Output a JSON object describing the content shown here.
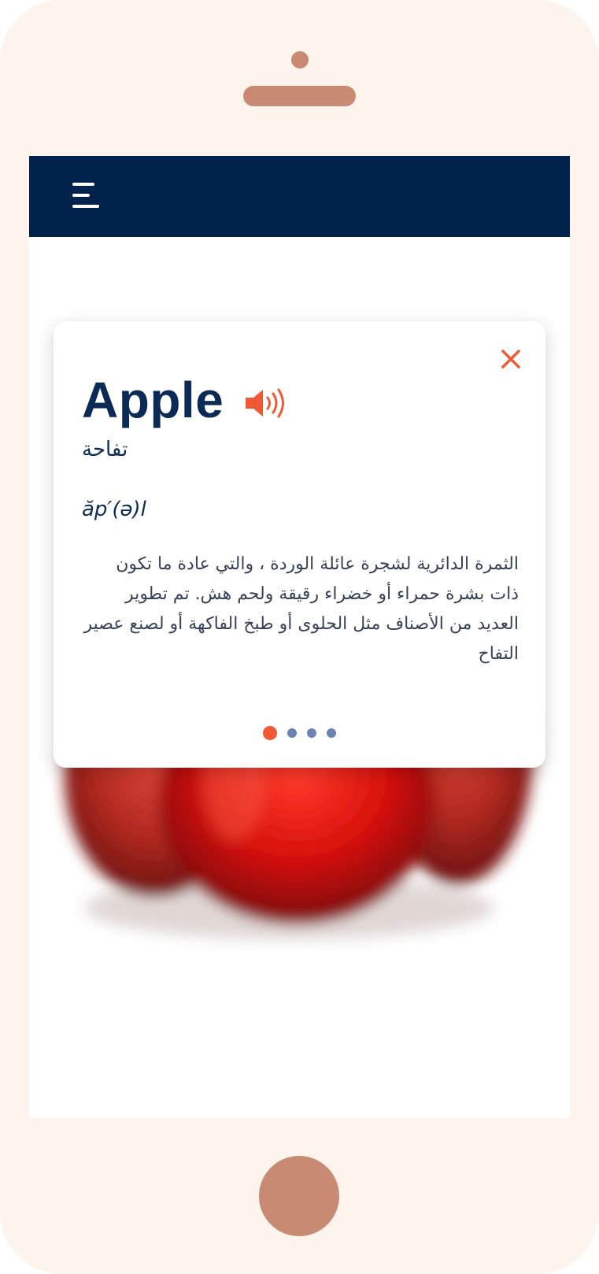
{
  "device": {
    "frame_color": "#fdf4ee",
    "accent_color": "#c98a73"
  },
  "header": {
    "background": "#00224b",
    "menu_icon": "hamburger-menu-icon"
  },
  "card": {
    "word": "Apple",
    "translation": "تفاحة",
    "phonetic": "ăp′(ə)l",
    "definition": "الثمرة الدائرية لشجرة عائلة الوردة ، والتي عادة ما تكون ذات بشرة حمراء أو خضراء رقيقة ولحم هش. تم تطوير العديد من الأصناف مثل الحلوى أو طبخ الفاكهة أو لصنع عصير التفاح",
    "close_icon": "close-icon",
    "sound_icon": "speaker-icon",
    "accent_color": "#ef5a34",
    "text_color": "#0b2a55"
  },
  "pagination": {
    "total": 4,
    "active_index": 0,
    "active_color": "#ef5a34",
    "inactive_color": "#6d83b3"
  },
  "background_image": {
    "subject": "red apples (blurred)"
  }
}
